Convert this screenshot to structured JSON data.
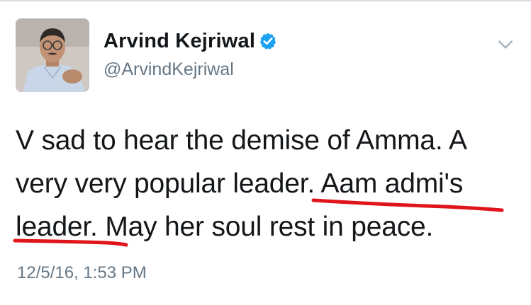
{
  "author": {
    "display_name": "Arvind Kejriwal",
    "handle": "@ArvindKejriwal",
    "verified": true,
    "avatar_icon": "profile-photo"
  },
  "tweet": {
    "text": "V sad to hear the demise of Amma. A very very popular leader. Aam admi's leader. May her soul rest in peace.",
    "timestamp": "12/5/16, 1:53 PM"
  },
  "icons": {
    "verified": "verified-badge-icon",
    "menu": "chevron-down-icon"
  },
  "colors": {
    "verified_blue": "#1da1f2",
    "annotation_red": "#e0141b",
    "text": "#14171a",
    "muted": "#657786"
  }
}
